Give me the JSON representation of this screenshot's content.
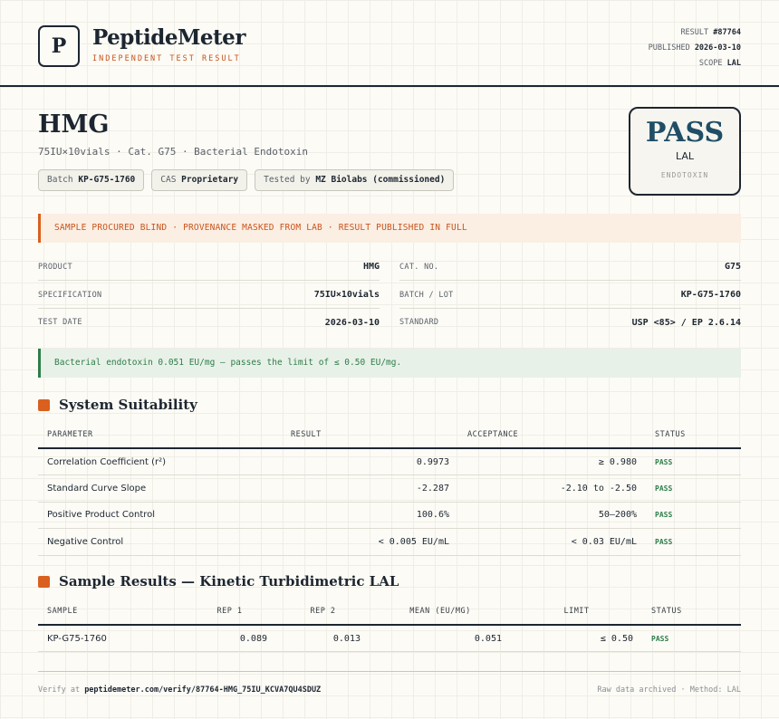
{
  "header": {
    "logo_letter": "P",
    "brand": "PeptideMeter",
    "brand_sub": "INDEPENDENT TEST RESULT",
    "result_label": "RESULT",
    "result_value": "#87764",
    "published_label": "PUBLISHED",
    "published_value": "2026-03-10",
    "scope_label": "SCOPE",
    "scope_value": "LAL"
  },
  "product": {
    "title": "HMG",
    "subtitle": "75IU×10vials · Cat. G75 · Bacterial Endotoxin",
    "chips": [
      {
        "label": "Batch",
        "value": "KP-G75-1760"
      },
      {
        "label": "CAS",
        "value": "Proprietary"
      },
      {
        "label": "Tested by",
        "value": "MZ Biolabs (commissioned)"
      }
    ]
  },
  "badge": {
    "word": "PASS",
    "method": "LAL",
    "category": "ENDOTOXIN"
  },
  "notice_warn": "SAMPLE PROCURED BLIND · PROVENANCE MASKED FROM LAB · RESULT PUBLISHED IN FULL",
  "info": {
    "left": [
      {
        "k": "PRODUCT",
        "v": "HMG"
      },
      {
        "k": "SPECIFICATION",
        "v": "75IU×10vials"
      },
      {
        "k": "TEST DATE",
        "v": "2026-03-10"
      }
    ],
    "right": [
      {
        "k": "CAT. NO.",
        "v": "G75"
      },
      {
        "k": "BATCH / LOT",
        "v": "KP-G75-1760"
      },
      {
        "k": "STANDARD",
        "v": "USP <85> / EP 2.6.14"
      }
    ]
  },
  "notice_ok": "Bacterial endotoxin 0.051 EU/mg — passes the limit of ≤ 0.50 EU/mg.",
  "suitability": {
    "title": "System Suitability",
    "headers": [
      "PARAMETER",
      "RESULT",
      "ACCEPTANCE",
      "STATUS"
    ],
    "rows": [
      {
        "param": "Correlation Coefficient (r²)",
        "result": "0.9973",
        "acceptance": "≥ 0.980",
        "status": "PASS"
      },
      {
        "param": "Standard Curve Slope",
        "result": "-2.287",
        "acceptance": "-2.10 to -2.50",
        "status": "PASS"
      },
      {
        "param": "Positive Product Control",
        "result": "100.6%",
        "acceptance": "50–200%",
        "status": "PASS"
      },
      {
        "param": "Negative Control",
        "result": "< 0.005 EU/mL",
        "acceptance": "< 0.03 EU/mL",
        "status": "PASS"
      }
    ]
  },
  "samples": {
    "title": "Sample Results — Kinetic Turbidimetric LAL",
    "headers": [
      "SAMPLE",
      "REP 1",
      "REP 2",
      "MEAN (EU/MG)",
      "LIMIT",
      "STATUS"
    ],
    "rows": [
      {
        "sample": "KP-G75-1760",
        "rep1": "0.089",
        "rep2": "0.013",
        "mean": "0.051",
        "limit": "≤ 0.50",
        "status": "PASS"
      }
    ]
  },
  "footer": {
    "verify_prefix": "Verify at",
    "verify_url": "peptidemeter.com/verify/87764-HMG_75IU_KCVA7QU4SDUZ",
    "right": "Raw data archived · Method: LAL"
  }
}
